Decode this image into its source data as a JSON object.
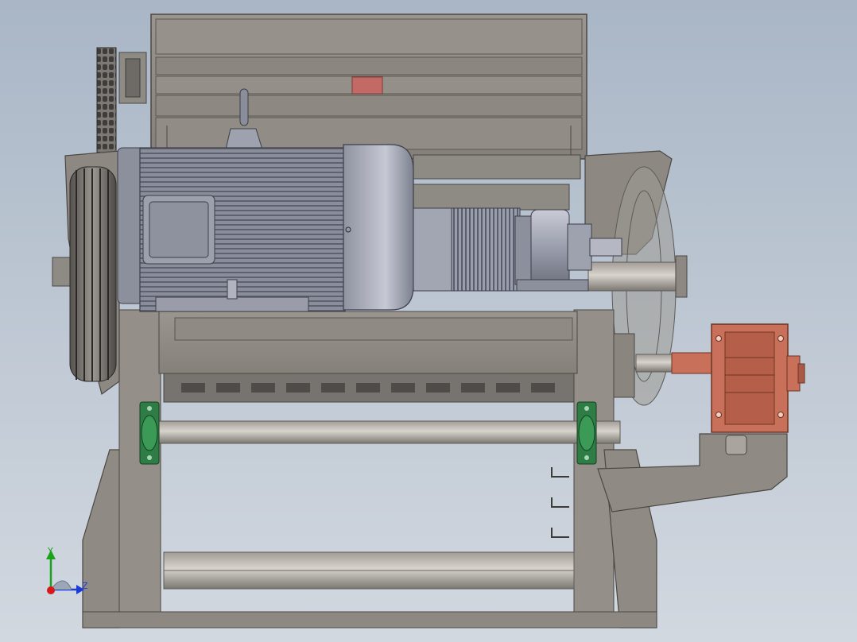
{
  "triad": {
    "y_label": "Y",
    "z_label": "Z"
  },
  "colors": {
    "frame": "#8e8a84",
    "frame_dark": "#5f5c58",
    "motor": "#8c8f9c",
    "motor_light": "#b4b7c3",
    "bearing_green": "#2e7d46",
    "gearbox": "#c8705a",
    "axis_y": "#1aa31a",
    "axis_z": "#1a3cd6",
    "axis_x": "#d61a1a"
  }
}
